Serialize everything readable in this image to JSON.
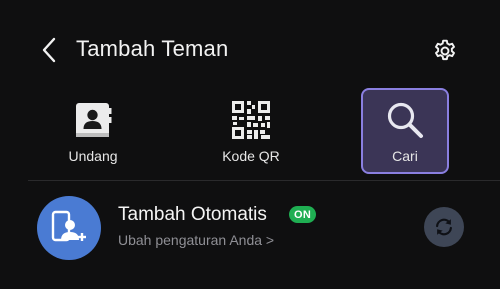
{
  "header": {
    "title": "Tambah Teman",
    "back_icon": "chevron-left-icon",
    "settings_icon": "gear-icon"
  },
  "actions": [
    {
      "label": "Undang",
      "icon": "contacts-book-icon"
    },
    {
      "label": "Kode QR",
      "icon": "qr-code-icon"
    },
    {
      "label": "Cari",
      "icon": "search-icon",
      "selected": true
    }
  ],
  "auto_add": {
    "title": "Tambah Otomatis",
    "badge": "ON",
    "subtitle": "Ubah pengaturan Anda >",
    "icon": "add-contact-phone-icon",
    "sync_icon": "sync-icon"
  },
  "colors": {
    "background": "#0f0f10",
    "accent_selected_border": "#8a7fe0",
    "accent_selected_fill": "#3b3556",
    "badge_green": "#1fae52",
    "avatar_blue": "#4a7bd3"
  }
}
